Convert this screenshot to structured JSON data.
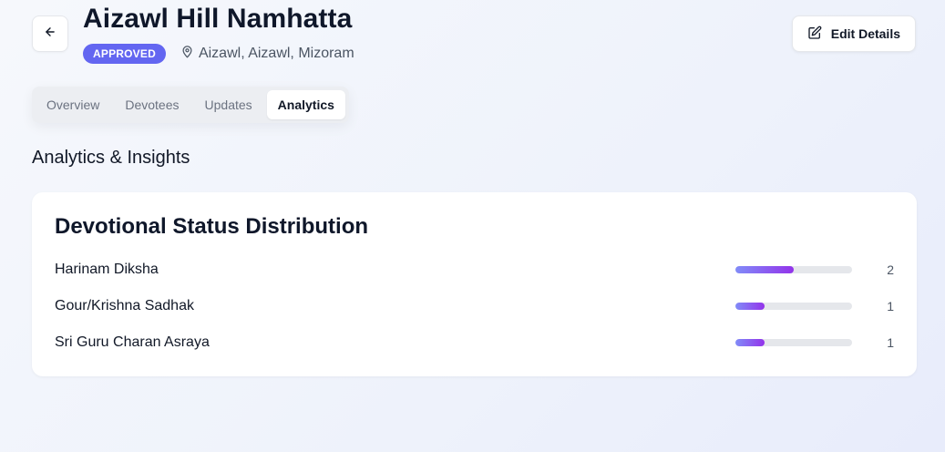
{
  "header": {
    "title": "Aizawl Hill Namhatta",
    "status": "APPROVED",
    "location": "Aizawl, Aizawl, Mizoram",
    "edit_label": "Edit Details"
  },
  "tabs": [
    {
      "label": "Overview",
      "active": false
    },
    {
      "label": "Devotees",
      "active": false
    },
    {
      "label": "Updates",
      "active": false
    },
    {
      "label": "Analytics",
      "active": true
    }
  ],
  "analytics": {
    "title": "Analytics & Insights",
    "card_title": "Devotional Status Distribution",
    "max": 4,
    "rows": [
      {
        "label": "Harinam Diksha",
        "count": "2",
        "value": 2
      },
      {
        "label": "Gour/Krishna Sadhak",
        "count": "1",
        "value": 1
      },
      {
        "label": "Sri Guru Charan Asraya",
        "count": "1",
        "value": 1
      }
    ]
  },
  "colors": {
    "accent": "#6366f1",
    "bar_start": "#818cf8",
    "bar_end": "#9333ea"
  }
}
